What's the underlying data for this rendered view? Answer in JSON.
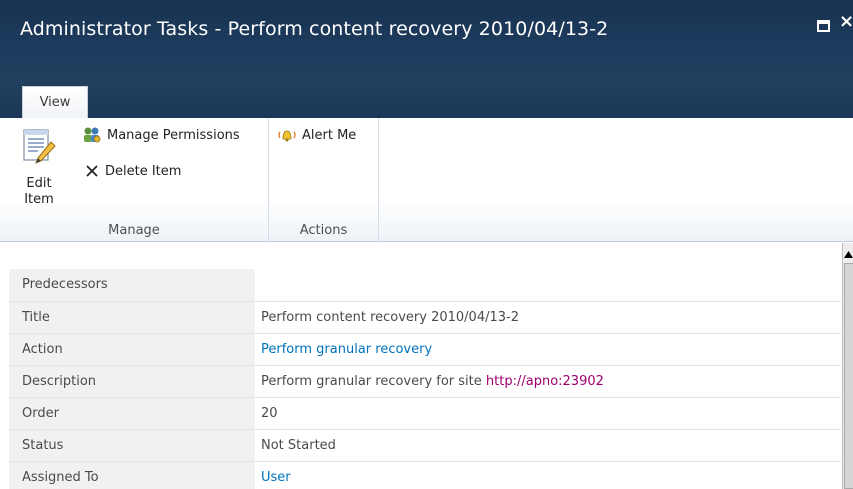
{
  "window": {
    "title": "Administrator Tasks - Perform content recovery 2010/04/13-2",
    "maximize_icon": "maximize-icon",
    "close_glyph": "×",
    "close_icon": "close-icon"
  },
  "tabs": [
    {
      "label": "View",
      "active": true
    }
  ],
  "ribbon": {
    "groups": [
      {
        "label": "Manage",
        "buttons": [
          {
            "label": "Edit Item",
            "icon": "edit-document-icon"
          },
          {
            "label": "Manage Permissions",
            "icon": "permissions-icon"
          },
          {
            "label": "Delete Item",
            "icon": "delete-x-icon"
          }
        ]
      },
      {
        "label": "Actions",
        "buttons": [
          {
            "label": "Alert Me",
            "icon": "alert-bell-icon"
          }
        ]
      }
    ]
  },
  "fields": [
    {
      "label": "Predecessors",
      "value": ""
    },
    {
      "label": "Title",
      "value": "Perform content recovery 2010/04/13-2"
    },
    {
      "label": "Action",
      "value": "Perform granular recovery",
      "link": true
    },
    {
      "label": "Description",
      "value": "Perform granular recovery for site ",
      "link_value": "http://apno:23902"
    },
    {
      "label": "Order",
      "value": "20"
    },
    {
      "label": "Status",
      "value": "Not Started"
    },
    {
      "label": "Assigned To",
      "value": "User",
      "link": true
    }
  ],
  "colors": {
    "titlebar": "#1d3a5c",
    "link": "#0072bc",
    "visited_link": "#a00070",
    "label_bg": "#f1f1f1"
  }
}
